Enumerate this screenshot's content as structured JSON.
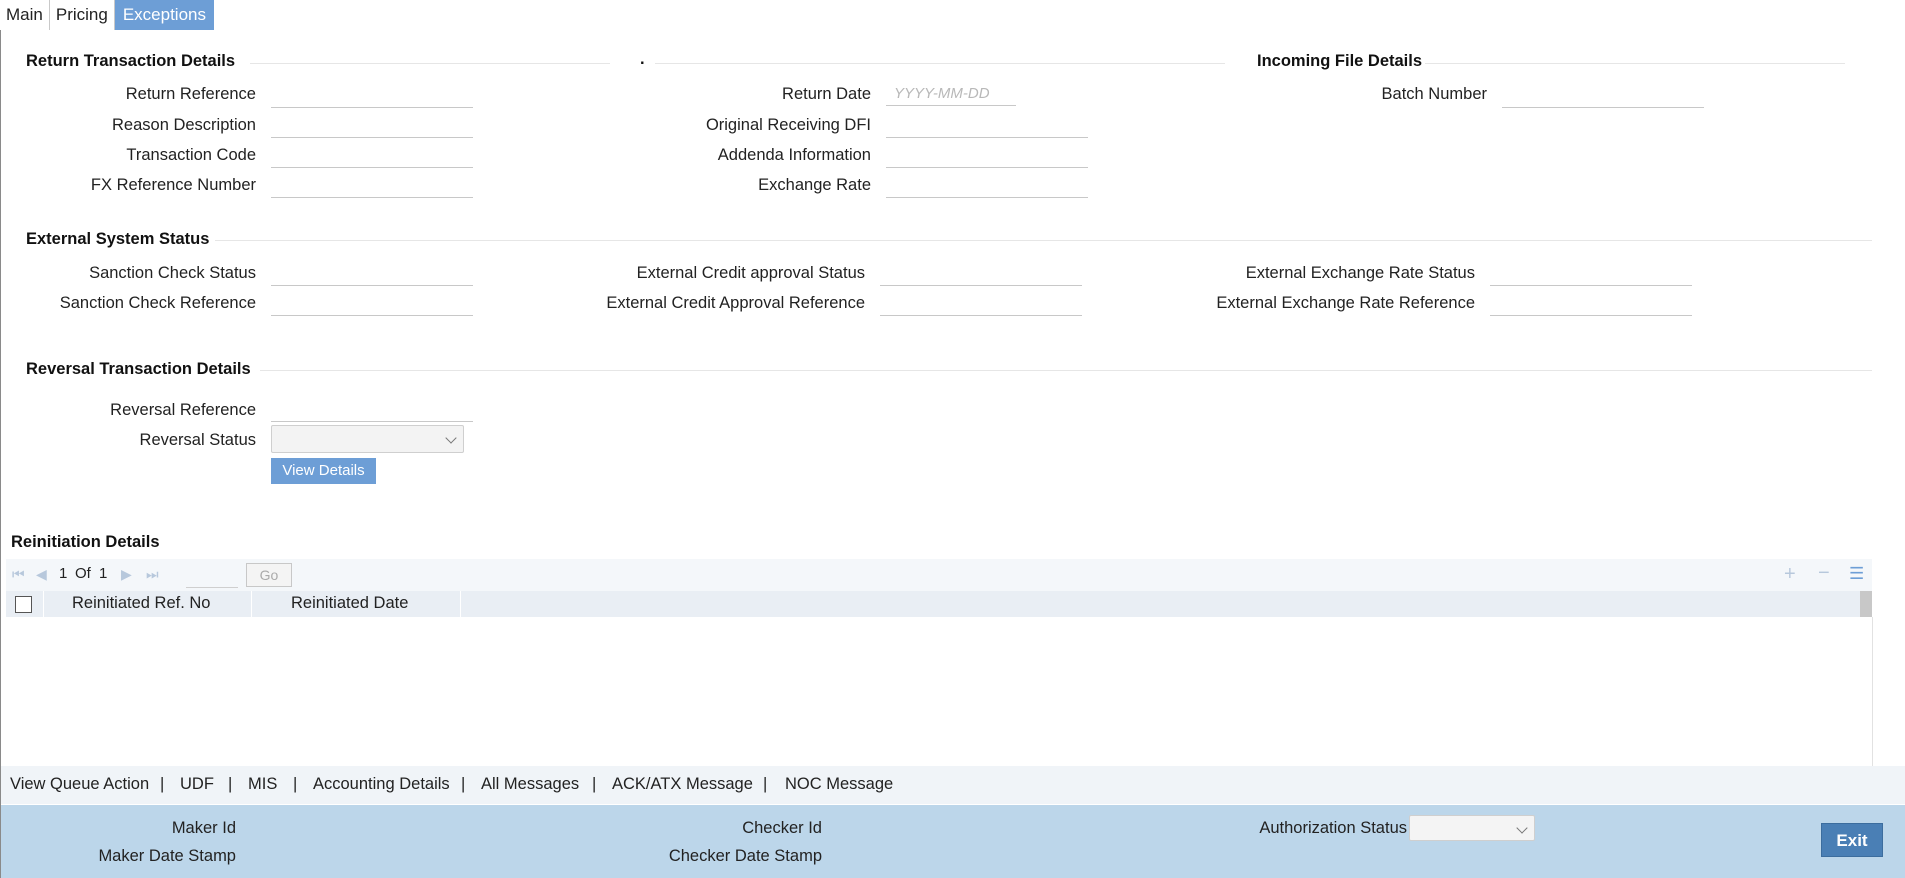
{
  "tabs": [
    "Main",
    "Pricing",
    "Exceptions"
  ],
  "return_section": {
    "title": "Return Transaction Details",
    "middle_title": ".",
    "fields_left": [
      "Return Reference",
      "Reason Description",
      "Transaction Code",
      "FX Reference Number"
    ],
    "fields_mid": [
      "Return Date",
      "Original Receiving DFI",
      "Addenda Information",
      "Exchange Rate"
    ],
    "date_placeholder": "YYYY-MM-DD"
  },
  "incoming_section": {
    "title": "Incoming File Details",
    "batch_label": "Batch Number"
  },
  "external_section": {
    "title": "External System Status",
    "col1": [
      "Sanction Check Status",
      "Sanction Check Reference"
    ],
    "col2": [
      "External Credit approval Status",
      "External Credit Approval Reference"
    ],
    "col3": [
      "External Exchange Rate Status",
      "External Exchange Rate Reference"
    ]
  },
  "reversal_section": {
    "title": "Reversal Transaction Details",
    "reference_label": "Reversal Reference",
    "status_label": "Reversal Status",
    "view_details": "View Details"
  },
  "reinitiation": {
    "title": "Reinitiation Details",
    "page_current": "1",
    "page_of": "Of",
    "page_total": "1",
    "go": "Go",
    "columns": [
      "Reinitiated Ref. No",
      "Reinitiated Date"
    ]
  },
  "footer_links": [
    "View Queue Action",
    "UDF",
    "MIS",
    "Accounting Details",
    "All Messages",
    "ACK/ATX Message",
    "NOC Message"
  ],
  "status_bar": {
    "maker_id": "Maker Id",
    "maker_date": "Maker Date Stamp",
    "checker_id": "Checker Id",
    "checker_date": "Checker Date Stamp",
    "auth_status": "Authorization Status",
    "exit": "Exit"
  },
  "colors": {
    "accent": "#6d9ed6",
    "status_bar": "#bcd6ea",
    "exit_button": "#4a7fb5"
  }
}
